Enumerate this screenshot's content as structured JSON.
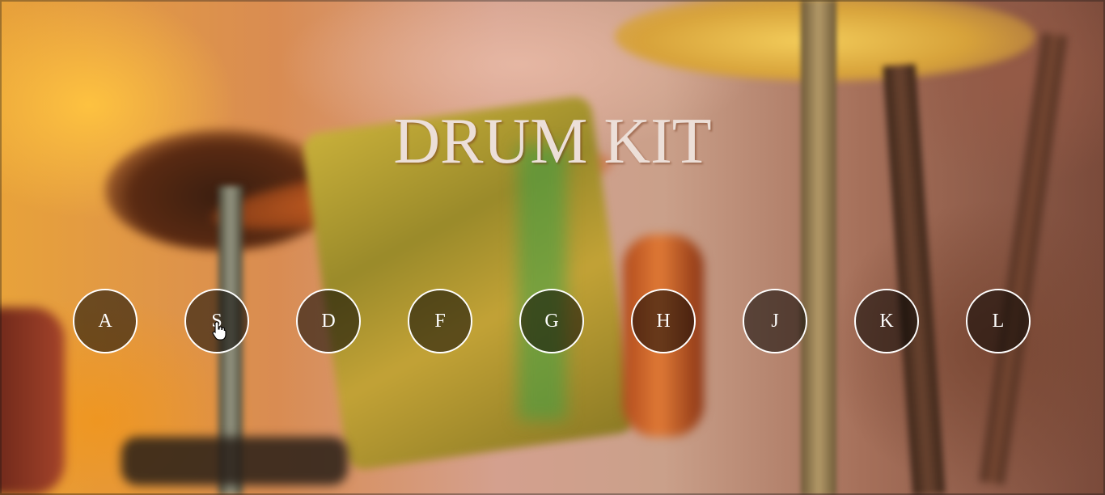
{
  "page": {
    "title": "DRUM KIT"
  },
  "keys": [
    {
      "label": "A"
    },
    {
      "label": "S"
    },
    {
      "label": "D"
    },
    {
      "label": "F"
    },
    {
      "label": "G"
    },
    {
      "label": "H"
    },
    {
      "label": "J"
    },
    {
      "label": "K"
    },
    {
      "label": "L"
    }
  ],
  "cursor": {
    "icon": "hand-pointer-icon",
    "hovering_key": "S"
  },
  "colors": {
    "title": "#ecdfd8",
    "key_border": "#ffffff",
    "key_text": "#ffffff"
  }
}
